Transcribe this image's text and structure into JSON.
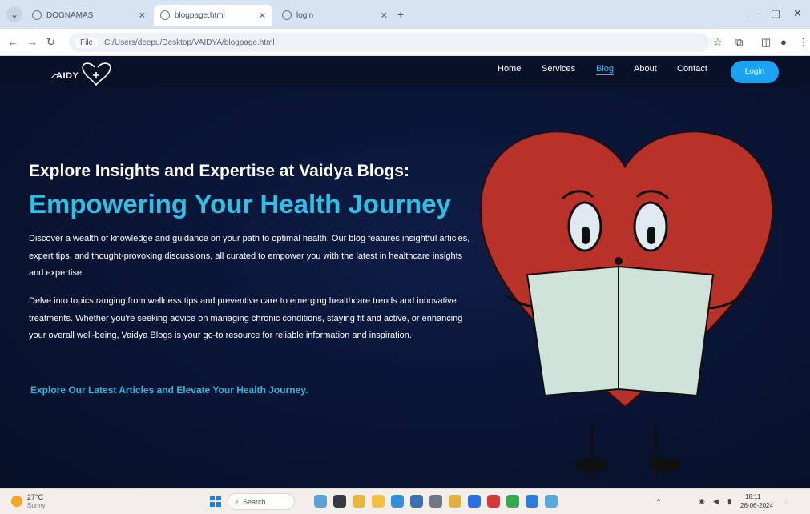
{
  "browser": {
    "tabs": [
      {
        "title": "DOGNAMAS",
        "active": false
      },
      {
        "title": "blogpage.html",
        "active": true
      },
      {
        "title": "login",
        "active": false
      }
    ],
    "new_tab_label": "+",
    "address": {
      "chip": "File",
      "url": "C:/Users/deepu/Desktop/VAIDYA/blogpage.html"
    }
  },
  "site": {
    "logo_text": "AIDY",
    "nav": [
      {
        "label": "Home",
        "active": false
      },
      {
        "label": "Services",
        "active": false
      },
      {
        "label": "Blog",
        "active": true
      },
      {
        "label": "About",
        "active": false
      },
      {
        "label": "Contact",
        "active": false
      }
    ],
    "login_label": "Login"
  },
  "hero": {
    "subtitle": "Explore Insights and Expertise at Vaidya Blogs:",
    "title": "Empowering Your Health Journey",
    "paragraph1": "Discover a wealth of knowledge and guidance on your path to optimal health. Our blog features insightful articles, expert tips, and thought-provoking discussions, all curated to empower you with the latest in healthcare insights and expertise.",
    "paragraph2": "Delve into topics ranging from wellness tips and preventive care to emerging healthcare trends and innovative treatments. Whether you're seeking advice on managing chronic conditions, staying fit and active, or enhancing your overall well-being, Vaidya Blogs is your go-to resource for reliable information and inspiration.",
    "cta": "Explore Our Latest Articles and Elevate Your Health Journey."
  },
  "taskbar": {
    "weather_temp": "27°C",
    "weather_desc": "Sunny",
    "search_label": "Search",
    "clock_time": "18:11",
    "clock_date": "26-06-2024"
  },
  "colors": {
    "accent": "#2bc2e8",
    "login_button": "#1aa3f2",
    "page_background": "#0a1638",
    "heart": "#b8322a"
  }
}
